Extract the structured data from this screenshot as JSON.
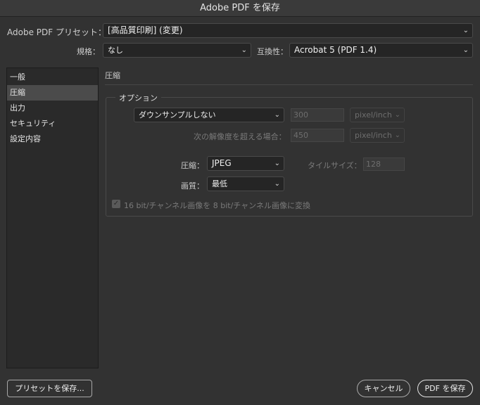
{
  "window": {
    "title": "Adobe PDF を保存"
  },
  "preset": {
    "label": "Adobe PDF プリセット：",
    "value": "[高品質印刷] (変更)"
  },
  "standard": {
    "label": "規格：",
    "value": "なし"
  },
  "compat": {
    "label": "互換性：",
    "value": "Acrobat 5 (PDF 1.4)"
  },
  "sidebar": {
    "items": [
      {
        "label": "一般"
      },
      {
        "label": "圧縮"
      },
      {
        "label": "出力"
      },
      {
        "label": "セキュリティ"
      },
      {
        "label": "設定内容"
      }
    ],
    "selected": "圧縮"
  },
  "section": {
    "title": "圧縮",
    "group_title": "オプション"
  },
  "options": {
    "downsample": {
      "value": "ダウンサンプルしない"
    },
    "ppi": {
      "value": "300",
      "unit": "pixel/inch"
    },
    "above": {
      "label": "次の解像度を超える場合：",
      "value": "450",
      "unit": "pixel/inch"
    },
    "compression": {
      "label": "圧縮：",
      "value": "JPEG"
    },
    "tile": {
      "label": "タイルサイズ：",
      "value": "128"
    },
    "quality": {
      "label": "画質：",
      "value": "最低"
    },
    "convert": {
      "label": "16 bit/チャンネル画像を 8 bit/チャンネル画像に変換",
      "checked": true
    }
  },
  "buttons": {
    "save_preset": "プリセットを保存...",
    "cancel": "キャンセル",
    "save_pdf": "PDF を保存"
  },
  "icons": {
    "dropdown": "chevron-down-icon",
    "check": "checkmark-icon"
  }
}
